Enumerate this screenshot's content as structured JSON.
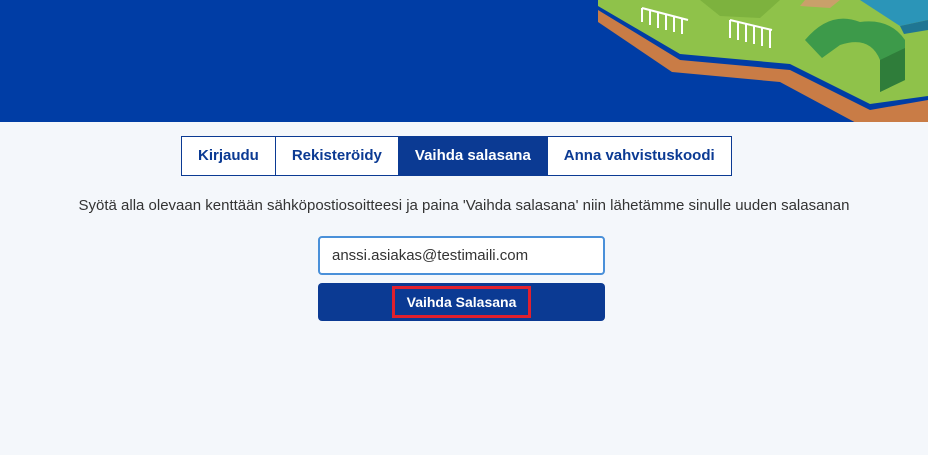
{
  "colors": {
    "header_blue": "#003da5",
    "tab_blue": "#0b3a93",
    "page_background": "#f4f7fb",
    "input_focus_border": "#4a90d9",
    "highlight_red": "#e0202e"
  },
  "header": {
    "illustration_icon": "isometric-landscape-illustration"
  },
  "tabs": [
    {
      "label": "Kirjaudu",
      "active": false
    },
    {
      "label": "Rekisteröidy",
      "active": false
    },
    {
      "label": "Vaihda salasana",
      "active": true
    },
    {
      "label": "Anna vahvistuskoodi",
      "active": false
    }
  ],
  "reset_form": {
    "instruction": "Syötä alla olevaan kenttään sähköpostiosoitteesi ja paina 'Vaihda salasana' niin lähetämme sinulle uuden salasanan",
    "email_value": "anssi.asiakas@testimaili.com",
    "submit_label": "Vaihda Salasana"
  }
}
